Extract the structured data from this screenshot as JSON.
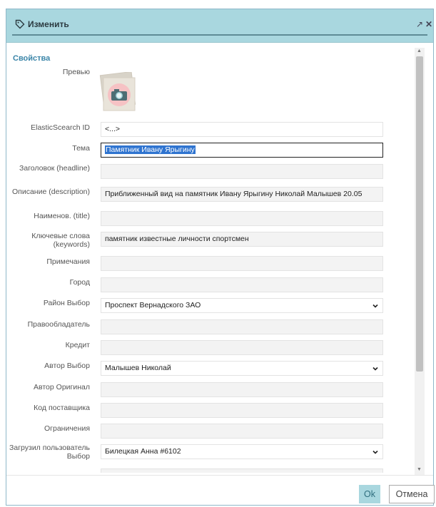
{
  "dialog": {
    "title": "Изменить",
    "ok_label": "Ok",
    "cancel_label": "Отмена"
  },
  "form": {
    "section_title": "Свойства",
    "preview_label": "Превью",
    "fields": [
      {
        "label": "ElasticScearch ID",
        "value": "<...>",
        "type": "readonly-white"
      },
      {
        "label": "Тема",
        "value": "Памятник Ивану Ярыгину",
        "type": "active"
      },
      {
        "label": "Заголовок (headline)",
        "value": "",
        "type": "text"
      },
      {
        "label": "Описание (description)",
        "value": "Приближенный вид на памятник Ивану Ярыгину Николай Малышев 20.05",
        "type": "text"
      },
      {
        "label": "Наименов. (title)",
        "value": "",
        "type": "text"
      },
      {
        "label": "Ключевые слова (keywords)",
        "value": "памятник известные личности спортсмен",
        "type": "text"
      },
      {
        "label": "Примечания",
        "value": "",
        "type": "text"
      },
      {
        "label": "Город",
        "value": "",
        "type": "text"
      },
      {
        "label": "Район Выбор",
        "value": "Проспект Вернадского ЗАО",
        "type": "select"
      },
      {
        "label": "Правообладатель",
        "value": "",
        "type": "text"
      },
      {
        "label": "Кредит",
        "value": "",
        "type": "text"
      },
      {
        "label": "Автор Выбор",
        "value": "Малышев Николай",
        "type": "select"
      },
      {
        "label": "Автор Оригинал",
        "value": "",
        "type": "text"
      },
      {
        "label": "Код поставщика",
        "value": "",
        "type": "text"
      },
      {
        "label": "Ограничения",
        "value": "",
        "type": "text"
      },
      {
        "label": "Загрузил пользователь Выбор",
        "value": "Билецкая Анна #6102",
        "type": "select"
      }
    ]
  },
  "icons": {
    "title_icon": "tag-icon",
    "expand_icon": "expand-icon",
    "close_icon": "close-icon",
    "preview_icon": "camera-icon",
    "dropdown_icon": "chevron-down-icon"
  },
  "colors": {
    "header_bg": "#a9d7df",
    "accent": "#3a85a8",
    "selection": "#2f74d0"
  }
}
